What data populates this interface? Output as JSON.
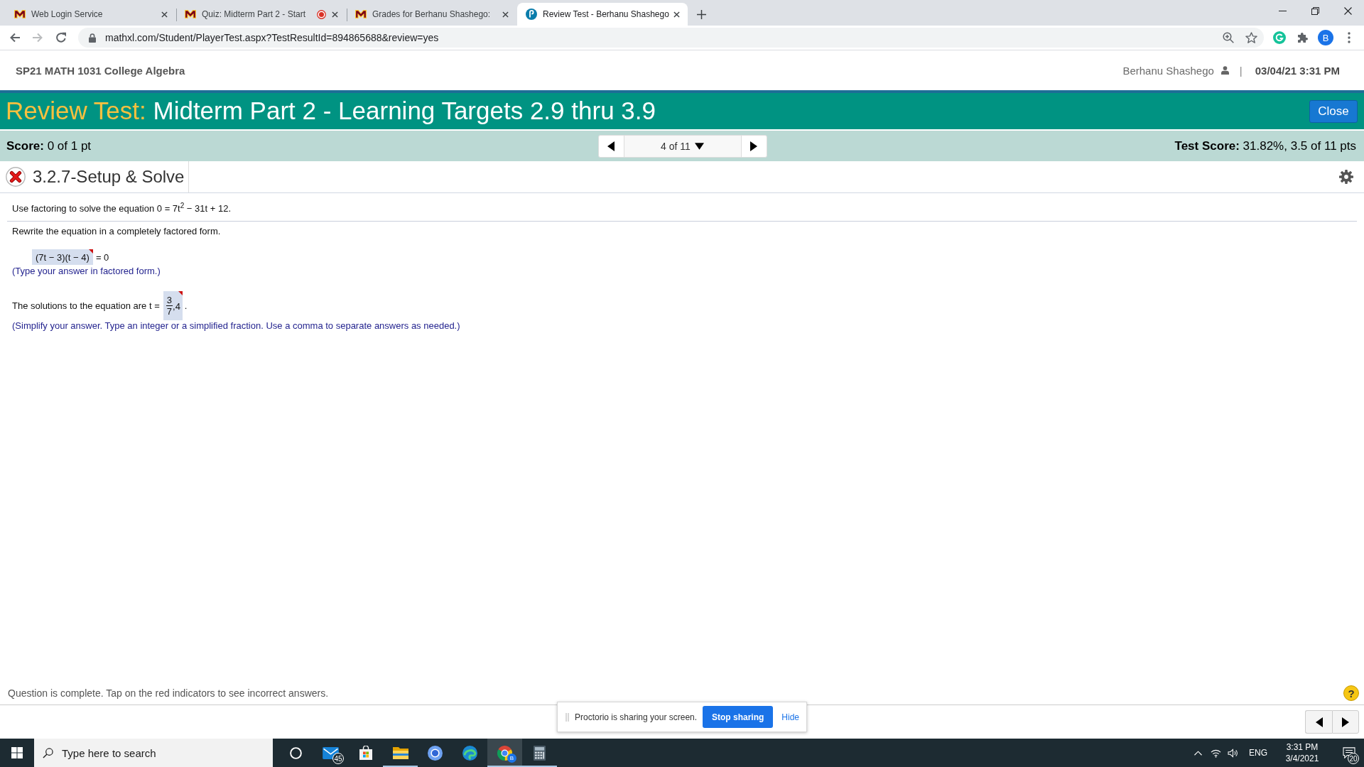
{
  "browser": {
    "tabs": [
      {
        "title": "Web Login Service",
        "kind": "block-m",
        "recording": false,
        "selected": false
      },
      {
        "title": "Quiz: Midterm Part 2 - Start",
        "kind": "block-m",
        "recording": true,
        "selected": false
      },
      {
        "title": "Grades for Berhanu Shashego:",
        "kind": "block-m",
        "recording": false,
        "selected": false
      },
      {
        "title": "Review Test - Berhanu Shashego",
        "kind": "round-p",
        "recording": false,
        "selected": true
      }
    ],
    "forward_enabled": false,
    "url": "mathxl.com/Student/PlayerTest.aspx?TestResultId=894865688&review=yes",
    "profile_initial": "B"
  },
  "header": {
    "course": "SP21 MATH 1031 College Algebra",
    "user": "Berhanu Shashego",
    "separator": "|",
    "datetime": "03/04/21 3:31 PM"
  },
  "banner": {
    "label": "Review Test:",
    "title": "Midterm Part 2 - Learning Targets 2.9 thru 3.9",
    "close_button": "Close"
  },
  "score_bar": {
    "score": "**Score:** 0 of 1 pt",
    "position": "4 of 11",
    "test_score": "**Test Score:** 31.82%, 3.5 of 11 pts"
  },
  "question": {
    "correct": false,
    "title": "3.2.7-Setup & Solve",
    "prompt": "Use factoring to solve the equation 0 = 7t$^{2}$ − 31t + 12.",
    "parts": [
      {
        "kind": "factored",
        "instruction": "Rewrite the equation in a completely factored form.",
        "answer": "(7t − 3)(t − 4)",
        "after": "= 0",
        "incorrect": true,
        "hint": "(Type your answer in factored form.)"
      },
      {
        "kind": "fraction",
        "lead": "The solutions to the equation are t =",
        "numerator": "3",
        "denominator": "7",
        "rest": ",4",
        "after": ".",
        "incorrect": true,
        "hint": "(Simplify your answer. Type an integer or a simplified fraction. Use a comma to separate answers as needed.)"
      }
    ]
  },
  "status": {
    "message": "Question is complete. Tap on the red indicators to see incorrect answers.",
    "help": "?"
  },
  "share_notice": {
    "message": "Proctorio is sharing your screen.",
    "stop_button": "Stop sharing",
    "hide_link": "Hide"
  },
  "taskbar": {
    "search_placeholder": "Type here to search",
    "apps": [
      {
        "kind": "ring",
        "running": false,
        "active": false
      },
      {
        "kind": "mail",
        "badge": "45",
        "running": false,
        "active": false
      },
      {
        "kind": "store",
        "running": false,
        "active": false
      },
      {
        "kind": "folder",
        "running": true,
        "active": false
      },
      {
        "kind": "orb",
        "running": false,
        "active": false
      },
      {
        "kind": "swirl",
        "running": false,
        "active": false
      },
      {
        "kind": "segmented",
        "badge": "B",
        "running": true,
        "active": true
      },
      {
        "kind": "calculator",
        "running": true,
        "active": false
      }
    ],
    "language": "ENG",
    "time": "3:31 PM",
    "date": "3/4/2021",
    "notifications": "20"
  }
}
